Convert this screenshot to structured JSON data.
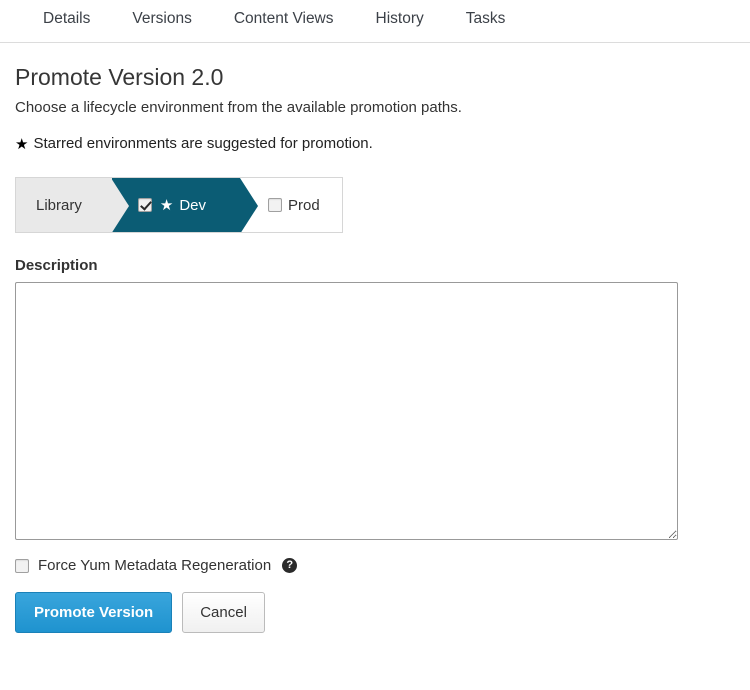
{
  "tabs": [
    {
      "label": "Details"
    },
    {
      "label": "Versions"
    },
    {
      "label": "Content Views"
    },
    {
      "label": "History"
    },
    {
      "label": "Tasks"
    }
  ],
  "page": {
    "title": "Promote Version 2.0",
    "subtitle": "Choose a lifecycle environment from the available promotion paths.",
    "starred_note": "Starred environments are suggested for promotion.",
    "star_glyph": "★"
  },
  "promotion_path": {
    "segments": [
      {
        "name": "Library",
        "label": "Library",
        "selectable": false,
        "checked": false,
        "starred": false
      },
      {
        "name": "Dev",
        "label": "Dev",
        "selectable": true,
        "checked": true,
        "starred": true,
        "star_glyph": "★"
      },
      {
        "name": "Prod",
        "label": "Prod",
        "selectable": true,
        "checked": false,
        "starred": false
      }
    ]
  },
  "description": {
    "label": "Description",
    "value": "",
    "placeholder": ""
  },
  "force_yum": {
    "label": "Force Yum Metadata Regeneration",
    "checked": false,
    "help_glyph": "?"
  },
  "buttons": {
    "primary_label": "Promote Version",
    "cancel_label": "Cancel"
  },
  "colors": {
    "selected_env": "#0b5c74",
    "library_env": "#e9e9e9",
    "primary_button": "#2196d3",
    "border": "#d6d6d6"
  }
}
